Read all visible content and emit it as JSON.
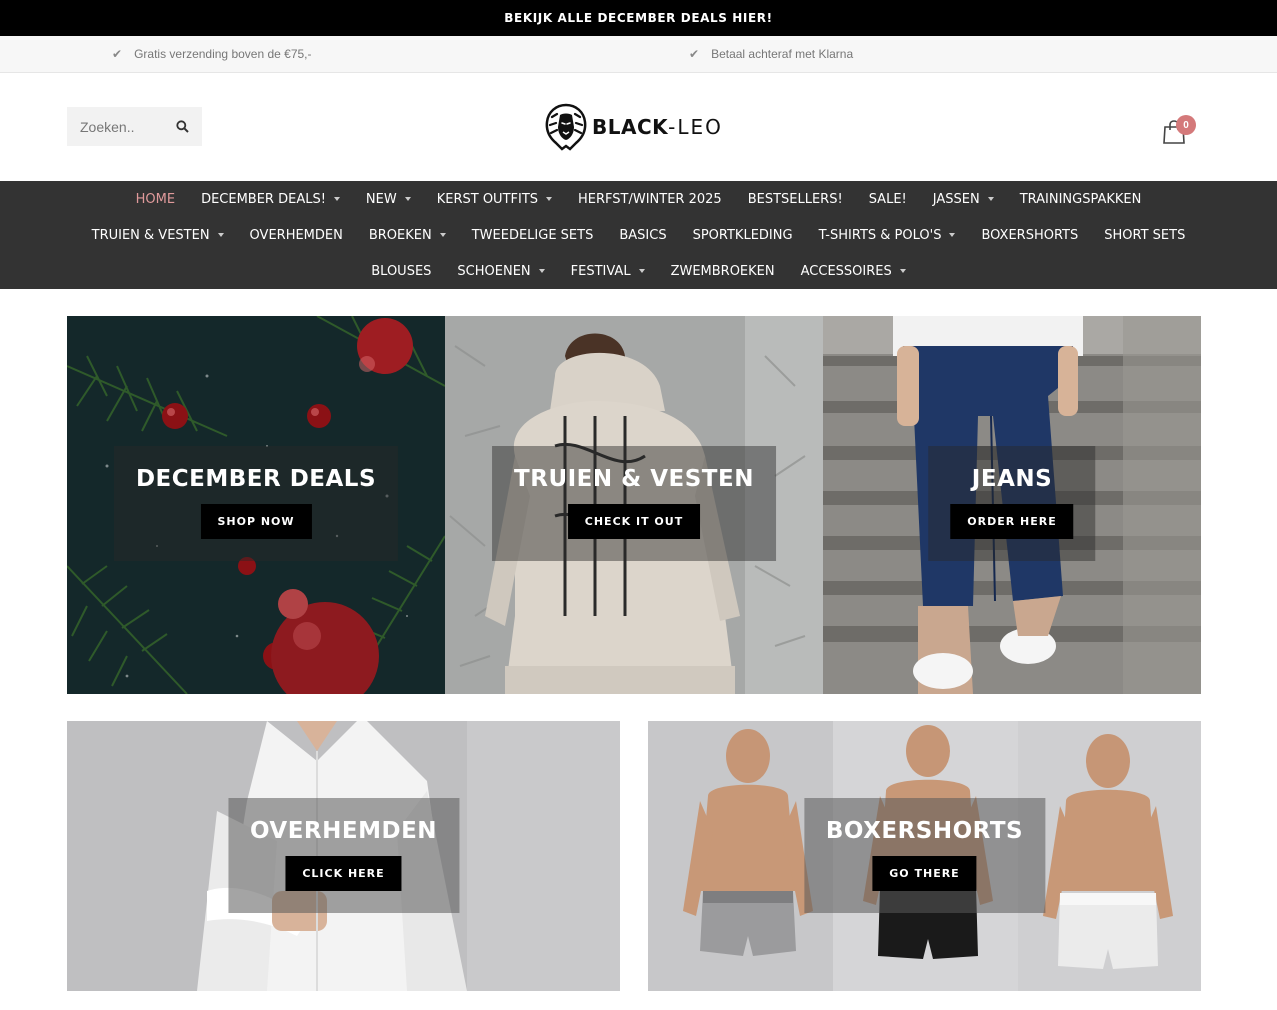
{
  "announcement": {
    "text": "BEKIJK ALLE DECEMBER DEALS HIER!"
  },
  "usps": [
    {
      "text": "Gratis verzending boven de €75,-"
    },
    {
      "text": "Betaal achteraf met Klarna"
    }
  ],
  "search": {
    "placeholder": "Zoeken.."
  },
  "logo": {
    "bold": "BLACK",
    "light": "-LEO"
  },
  "cart": {
    "count": "0"
  },
  "nav": {
    "row1": [
      {
        "label": "HOME",
        "active": true
      },
      {
        "label": "DECEMBER DEALS!",
        "dropdown": true
      },
      {
        "label": "NEW",
        "dropdown": true
      },
      {
        "label": "KERST OUTFITS",
        "dropdown": true
      },
      {
        "label": "HERFST/WINTER 2025"
      },
      {
        "label": "BESTSELLERS!"
      },
      {
        "label": "SALE!"
      },
      {
        "label": "JASSEN",
        "dropdown": true
      },
      {
        "label": "TRAININGSPAKKEN"
      }
    ],
    "row2": [
      {
        "label": "TRUIEN & VESTEN",
        "dropdown": true
      },
      {
        "label": "OVERHEMDEN"
      },
      {
        "label": "BROEKEN",
        "dropdown": true
      },
      {
        "label": "TWEEDELIGE SETS"
      },
      {
        "label": "BASICS"
      },
      {
        "label": "SPORTKLEDING"
      },
      {
        "label": "T-SHIRTS & POLO'S",
        "dropdown": true
      },
      {
        "label": "BOXERSHORTS"
      },
      {
        "label": "SHORT SETS"
      }
    ],
    "row3": [
      {
        "label": "BLOUSES"
      },
      {
        "label": "SCHOENEN",
        "dropdown": true
      },
      {
        "label": "FESTIVAL",
        "dropdown": true
      },
      {
        "label": "ZWEMBROEKEN"
      },
      {
        "label": "ACCESSOIRES",
        "dropdown": true
      }
    ]
  },
  "banners": {
    "december": {
      "title": "DECEMBER DEALS",
      "button": "SHOP NOW"
    },
    "truien": {
      "title": "TRUIEN & VESTEN",
      "button": "CHECK IT OUT"
    },
    "jeans": {
      "title": "JEANS",
      "button": "ORDER HERE"
    },
    "overhemden": {
      "title": "OVERHEMDEN",
      "button": "CLICK HERE"
    },
    "boxershorts": {
      "title": "BOXERSHORTS",
      "button": "GO THERE"
    }
  },
  "colors": {
    "accent": "#e09a9b",
    "nav_bg": "#333333",
    "badge": "#d4797a"
  }
}
